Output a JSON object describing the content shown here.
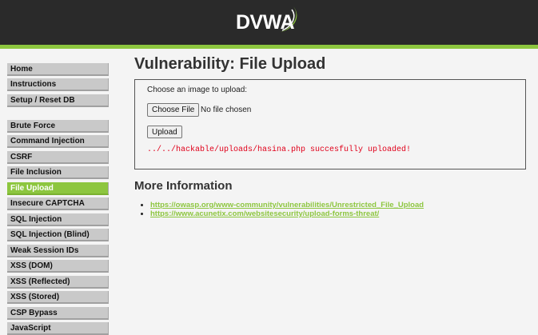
{
  "header": {
    "logo_text": "DVWA",
    "brand_color": "#8dc63f",
    "bar_color": "#2a2a2a"
  },
  "menu": {
    "group1": [
      {
        "label": "Home"
      },
      {
        "label": "Instructions"
      },
      {
        "label": "Setup / Reset DB"
      }
    ],
    "group2": [
      {
        "label": "Brute Force"
      },
      {
        "label": "Command Injection"
      },
      {
        "label": "CSRF"
      },
      {
        "label": "File Inclusion"
      },
      {
        "label": "File Upload",
        "active": true
      },
      {
        "label": "Insecure CAPTCHA"
      },
      {
        "label": "SQL Injection"
      },
      {
        "label": "SQL Injection (Blind)"
      },
      {
        "label": "Weak Session IDs"
      },
      {
        "label": "XSS (DOM)"
      },
      {
        "label": "XSS (Reflected)"
      },
      {
        "label": "XSS (Stored)"
      },
      {
        "label": "CSP Bypass"
      },
      {
        "label": "JavaScript"
      }
    ]
  },
  "main": {
    "title": "Vulnerability: File Upload",
    "upload_label": "Choose an image to upload:",
    "choose_file_label": "Choose File",
    "file_status": "No file chosen",
    "upload_button_label": "Upload",
    "result_message": "../../hackable/uploads/hasina.php succesfully uploaded!",
    "result_color": "#e0001a"
  },
  "more_info": {
    "heading": "More Information",
    "links": [
      "https://owasp.org/www-community/vulnerabilities/Unrestricted_File_Upload",
      "https://www.acunetix.com/websitesecurity/upload-forms-threat/"
    ]
  }
}
